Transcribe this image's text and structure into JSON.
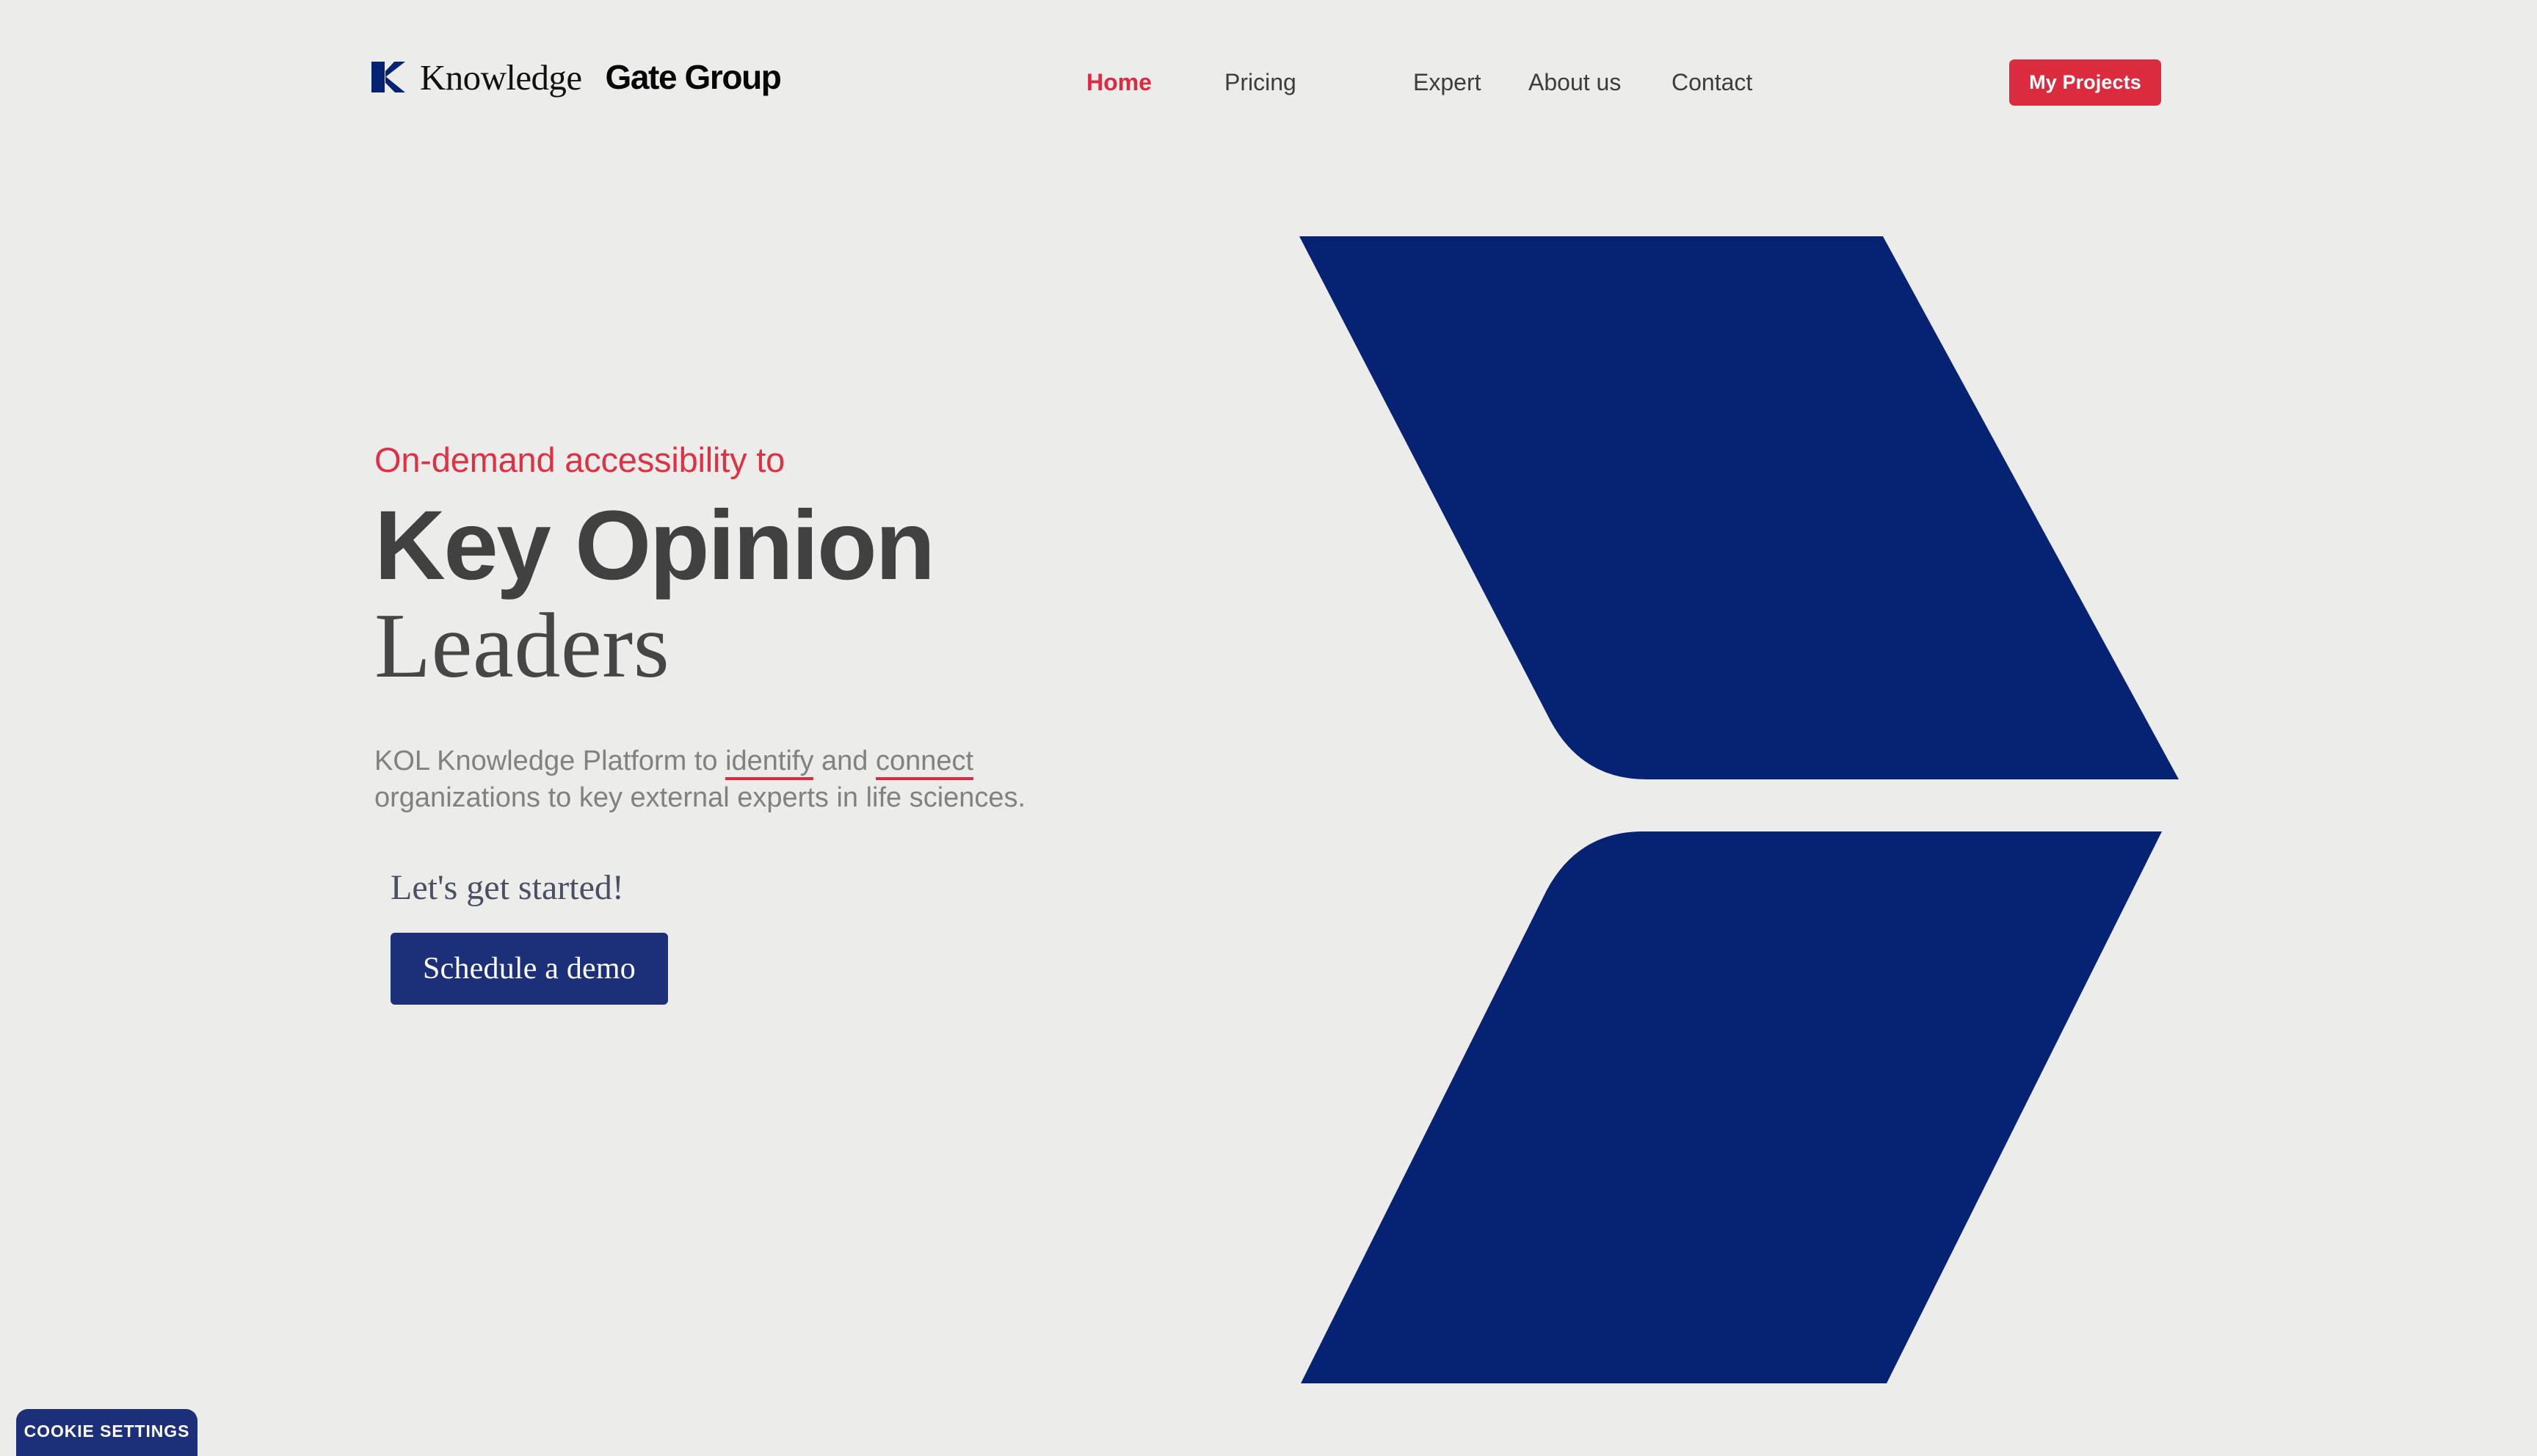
{
  "colors": {
    "background": "#ECECEA",
    "navy": "#052273",
    "navy_button": "#1C3079",
    "red_accent": "#DC2B40",
    "red_eyebrow": "#DC3244",
    "headline_gray": "#414141",
    "body_gray": "#818181"
  },
  "header": {
    "logo": {
      "mark_icon": "knowledge-gate-k-icon",
      "word_serif": "Knowledge",
      "word_bold": "Gate Group"
    },
    "nav": [
      {
        "label": "Home",
        "active": true
      },
      {
        "label": "Pricing",
        "active": false
      },
      {
        "label": "Expert",
        "active": false
      },
      {
        "label": "About us",
        "active": false
      },
      {
        "label": "Contact",
        "active": false
      }
    ],
    "projects_button": "My Projects"
  },
  "hero": {
    "eyebrow": "On-demand accessibility to",
    "headline_bold": "Key Opinion",
    "headline_serif": "Leaders",
    "description": {
      "part1": "KOL Knowledge Platform to ",
      "link1": "identify",
      "part2": " and ",
      "link2": "connect",
      "part3": " organizations to key external experts in life sciences."
    },
    "cta_heading": "Let's get started!",
    "cta_button": "Schedule a demo"
  },
  "cookie": {
    "button": "COOKIE SETTINGS"
  }
}
